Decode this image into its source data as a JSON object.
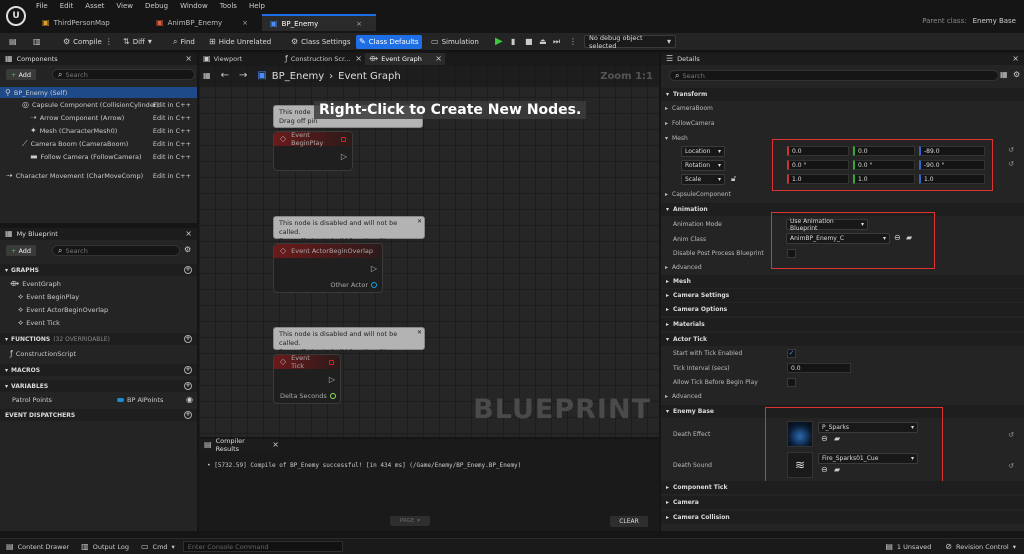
{
  "menu": [
    "File",
    "Edit",
    "Asset",
    "View",
    "Debug",
    "Window",
    "Tools",
    "Help"
  ],
  "tabs": [
    {
      "label": "ThirdPersonMap"
    },
    {
      "label": "AnimBP_Enemy"
    },
    {
      "label": "BP_Enemy"
    }
  ],
  "parent_class": {
    "label": "Parent class:",
    "value": "Enemy Base"
  },
  "toolbar": {
    "compile": "Compile",
    "diff": "Diff",
    "find": "Find",
    "hide_unrelated": "Hide Unrelated",
    "class_settings": "Class Settings",
    "class_defaults": "Class Defaults",
    "simulation": "Simulation",
    "debug_select": "No debug object selected"
  },
  "components": {
    "title": "Components",
    "add": "Add",
    "search_placeholder": "Search",
    "items": [
      {
        "label": "BP_Enemy (Self)"
      },
      {
        "label": "Capsule Component (CollisionCylinder)",
        "edit": "Edit in C++"
      },
      {
        "label": "Arrow Component (Arrow)",
        "edit": "Edit in C++"
      },
      {
        "label": "Mesh (CharacterMesh0)",
        "edit": "Edit in C++"
      },
      {
        "label": "Camera Boom (CameraBoom)",
        "edit": "Edit in C++"
      },
      {
        "label": "Follow Camera (FollowCamera)",
        "edit": "Edit in C++"
      },
      {
        "label": "Character Movement (CharMoveComp)",
        "edit": "Edit in C++"
      }
    ]
  },
  "my_blueprint": {
    "title": "My Blueprint",
    "add": "Add",
    "search_placeholder": "Search",
    "graphs": "GRAPHS",
    "event_graph": "EventGraph",
    "events": [
      "Event BeginPlay",
      "Event ActorBeginOverlap",
      "Event Tick"
    ],
    "functions": "FUNCTIONS",
    "functions_count": "(32 OVERRIDABLE)",
    "construction_script": "ConstructionScript",
    "macros": "MACROS",
    "variables": "VARIABLES",
    "var_name": "Patrol Points",
    "var_type": "BP AIPoints",
    "dispatchers": "EVENT DISPATCHERS"
  },
  "graph_tabs": {
    "viewport": "Viewport",
    "construction": "Construction Scr...",
    "event_graph": "Event Graph"
  },
  "graph": {
    "breadcrumb_root": "BP_Enemy",
    "breadcrumb_sep": "›",
    "breadcrumb_leaf": "Event Graph",
    "zoom": "Zoom 1:1",
    "hint": "Right-Click to Create New Nodes.",
    "watermark": "BLUEPRINT",
    "warn_line1": "This node is disabled and will not be called.",
    "warn_line2": "Drag off pins to build functionality.",
    "warn_partial": "This node",
    "warn_partial2": "Drag off pin",
    "node_begin": "Event BeginPlay",
    "node_overlap": "Event ActorBeginOverlap",
    "pin_other_actor": "Other Actor",
    "node_tick": "Event Tick",
    "pin_delta": "Delta Seconds"
  },
  "compiler": {
    "title": "Compiler Results",
    "message": "[5732.59] Compile of BP_Enemy successful! [in 434 ms] (/Game/Enemy/BP_Enemy.BP_Enemy)",
    "page": "PAGE",
    "clear": "CLEAR"
  },
  "details": {
    "title": "Details",
    "search_placeholder": "Search",
    "transform": "Transform",
    "camera_boom": "CameraBoom",
    "follow_camera": "FollowCamera",
    "mesh_sub": "Mesh",
    "location": "Location",
    "rotation": "Rotation",
    "scale": "Scale",
    "loc": [
      "0.0",
      "0.0",
      "-89.0"
    ],
    "rot": [
      "0.0 °",
      "0.0 °",
      "-90.0 °"
    ],
    "scl": [
      "1.0",
      "1.0",
      "1.0"
    ],
    "capsule": "CapsuleComponent",
    "animation": "Animation",
    "anim_mode_label": "Animation Mode",
    "anim_mode_value": "Use Animation Blueprint",
    "anim_class_label": "Anim Class",
    "anim_class_value": "AnimBP_Enemy_C",
    "disable_pp": "Disable Post Process Blueprint",
    "advanced": "Advanced",
    "mesh": "Mesh",
    "camera_settings": "Camera Settings",
    "camera_options": "Camera Options",
    "materials": "Materials",
    "actor_tick": "Actor Tick",
    "start_tick": "Start with Tick Enabled",
    "tick_interval": "Tick Interval (secs)",
    "tick_interval_value": "0.0",
    "allow_tick": "Allow Tick Before Begin Play",
    "advanced2": "Advanced",
    "enemy_base": "Enemy Base",
    "death_effect": "Death Effect",
    "death_effect_value": "P_Sparks",
    "death_sound": "Death Sound",
    "death_sound_value": "Fire_Sparks01_Cue",
    "component_tick": "Component Tick",
    "camera": "Camera",
    "camera_collision": "Camera Collision"
  },
  "status": {
    "content_drawer": "Content Drawer",
    "output_log": "Output Log",
    "cmd": "Cmd",
    "console_placeholder": "Enter Console Command",
    "unsaved": "1 Unsaved",
    "revision": "Revision Control"
  }
}
